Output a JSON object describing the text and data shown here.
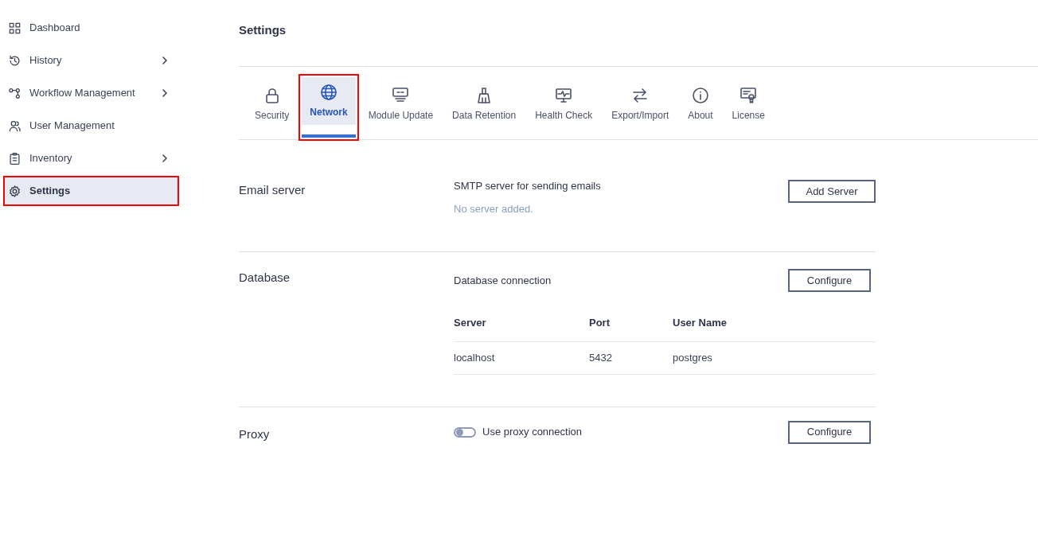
{
  "sidebar": {
    "items": [
      {
        "label": "Dashboard",
        "selected": false,
        "expandable": false,
        "highlighted": false
      },
      {
        "label": "History",
        "selected": false,
        "expandable": true,
        "highlighted": false
      },
      {
        "label": "Workflow Management",
        "selected": false,
        "expandable": true,
        "highlighted": false
      },
      {
        "label": "User Management",
        "selected": false,
        "expandable": false,
        "highlighted": false
      },
      {
        "label": "Inventory",
        "selected": false,
        "expandable": true,
        "highlighted": false
      },
      {
        "label": "Settings",
        "selected": true,
        "expandable": false,
        "highlighted": true
      }
    ]
  },
  "page": {
    "title": "Settings"
  },
  "tabs": [
    {
      "label": "Security",
      "selected": false,
      "highlighted": false
    },
    {
      "label": "Network",
      "selected": true,
      "highlighted": true
    },
    {
      "label": "Module Update",
      "selected": false,
      "highlighted": false
    },
    {
      "label": "Data Retention",
      "selected": false,
      "highlighted": false
    },
    {
      "label": "Health Check",
      "selected": false,
      "highlighted": false
    },
    {
      "label": "Export/Import",
      "selected": false,
      "highlighted": false
    },
    {
      "label": "About",
      "selected": false,
      "highlighted": false
    },
    {
      "label": "License",
      "selected": false,
      "highlighted": false
    }
  ],
  "email_server": {
    "heading": "Email server",
    "label": "SMTP server for sending emails",
    "note": "No server added.",
    "button": "Add Server"
  },
  "database": {
    "heading": "Database",
    "label": "Database connection",
    "button": "Configure",
    "table": {
      "columns": [
        "Server",
        "Port",
        "User Name"
      ],
      "rows": [
        [
          "localhost",
          "5432",
          "postgres"
        ]
      ]
    }
  },
  "proxy": {
    "heading": "Proxy",
    "toggle": {
      "label": "Use proxy connection",
      "on": false
    },
    "button": "Configure"
  }
}
